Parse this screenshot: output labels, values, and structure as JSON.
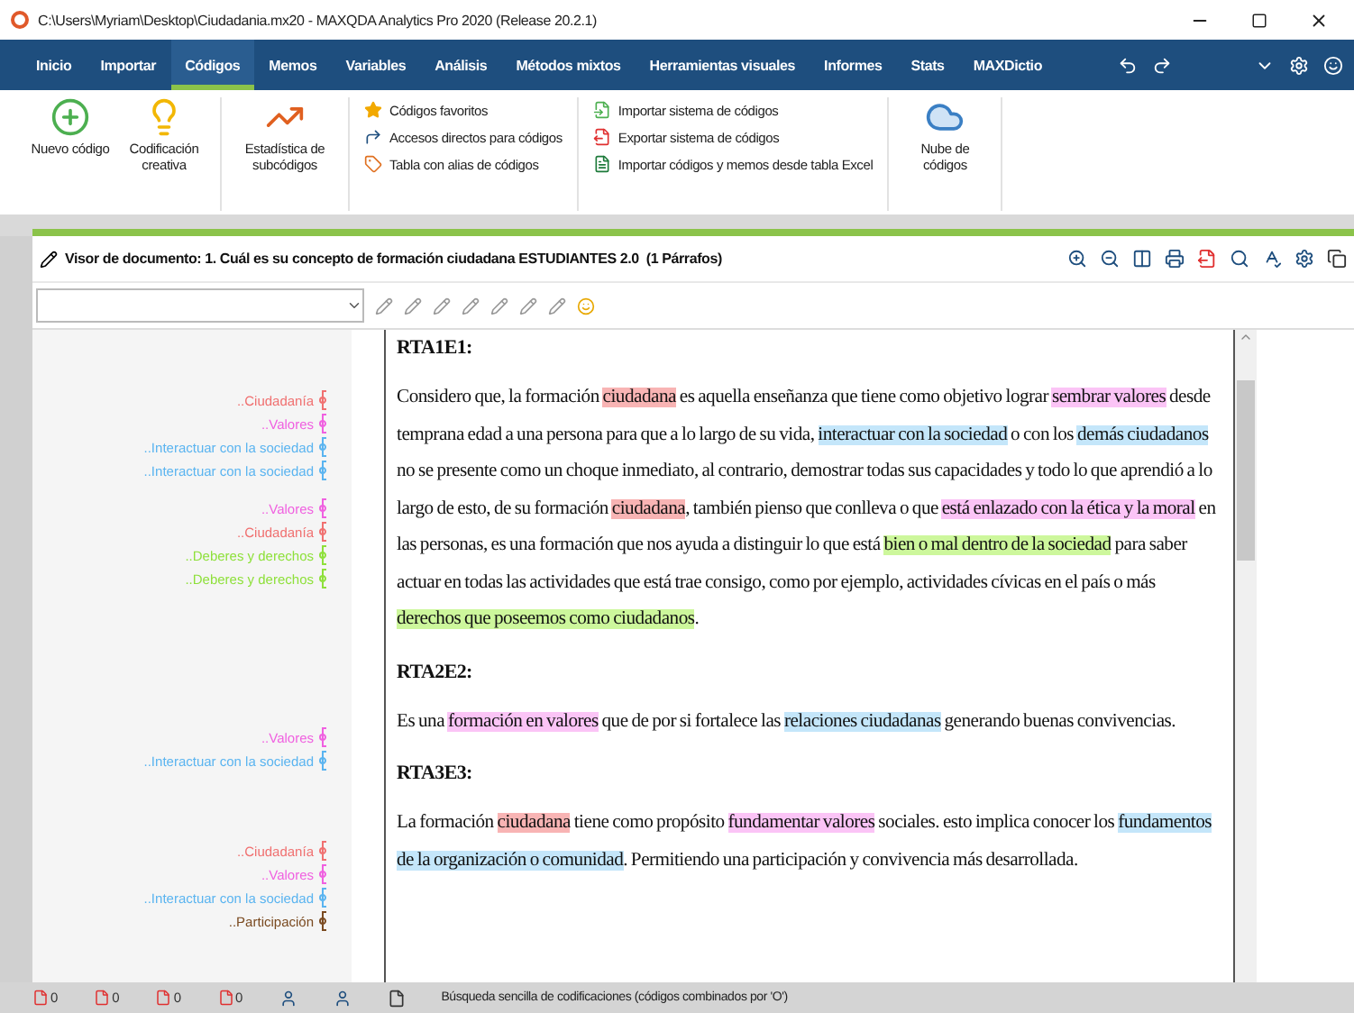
{
  "window": {
    "title": "C:\\Users\\Myriam\\Desktop\\Ciudadania.mx20 - MAXQDA Analytics Pro 2020 (Release 20.2.1)"
  },
  "menu": {
    "tabs": [
      {
        "label": "Inicio",
        "selected": false
      },
      {
        "label": "Importar",
        "selected": false
      },
      {
        "label": "Códigos",
        "selected": true
      },
      {
        "label": "Memos",
        "selected": false
      },
      {
        "label": "Variables",
        "selected": false
      },
      {
        "label": "Análisis",
        "selected": false
      },
      {
        "label": "Métodos mixtos",
        "selected": false
      },
      {
        "label": "Herramientas visuales",
        "selected": false
      },
      {
        "label": "Informes",
        "selected": false
      },
      {
        "label": "Stats",
        "selected": false
      },
      {
        "label": "MAXDictio",
        "selected": false
      }
    ]
  },
  "ribbon": {
    "large_buttons": [
      {
        "kind": "new",
        "label": "Nuevo código"
      },
      {
        "kind": "creative",
        "label": "Codificación creativa"
      },
      {
        "kind": "stats",
        "label": "Estadística de subcódigos"
      }
    ],
    "list_1": [
      {
        "kind": "star",
        "label": "Códigos favoritos"
      },
      {
        "kind": "shortcut",
        "label": "Accesos directos para códigos"
      },
      {
        "kind": "tag",
        "label": "Tabla con alias de códigos"
      }
    ],
    "list_2": [
      {
        "kind": "import",
        "label": "Importar sistema de códigos"
      },
      {
        "kind": "export",
        "label": "Exportar sistema de códigos"
      },
      {
        "kind": "excel",
        "label": "Importar códigos y memos desde tabla Excel"
      }
    ],
    "cloud_button": "Nube de códigos"
  },
  "viewer": {
    "title": "Visor de documento: 1. Cuál es su concepto de formación ciudadana ESTUDIANTES 2.0",
    "count": "(1 Párrafos)"
  },
  "margin_groups": [
    {
      "codes": [
        {
          "label": "..Ciudadanía",
          "color": "#f07070"
        },
        {
          "label": "..Valores",
          "color": "#f060e0"
        },
        {
          "label": "..Interactuar con la sociedad",
          "color": "#5ab4f0"
        },
        {
          "label": "..Interactuar con la sociedad",
          "color": "#5ab4f0"
        }
      ]
    },
    {
      "codes": [
        {
          "label": "..Valores",
          "color": "#f060e0"
        },
        {
          "label": "..Ciudadanía",
          "color": "#f07070"
        },
        {
          "label": "..Deberes y derechos",
          "color": "#8ee03a"
        },
        {
          "label": "..Deberes y derechos",
          "color": "#8ee03a"
        }
      ]
    },
    {
      "codes": [
        {
          "label": "..Valores",
          "color": "#f060e0"
        },
        {
          "label": "..Interactuar con la sociedad",
          "color": "#5ab4f0"
        }
      ]
    },
    {
      "codes": [
        {
          "label": "..Ciudadanía",
          "color": "#f07070"
        },
        {
          "label": "..Valores",
          "color": "#f060e0"
        },
        {
          "label": "..Interactuar con la sociedad",
          "color": "#5ab4f0"
        },
        {
          "label": "..Participación",
          "color": "#7a4a20"
        }
      ]
    }
  ],
  "paragraphs": [
    {
      "heading": "RTA1E1:",
      "segments": [
        {
          "text": "Considero que, la formación "
        },
        {
          "text": "ciudadana",
          "color": "#f8b4b4"
        },
        {
          "text": " es aquella enseñanza que tiene como objetivo lograr "
        },
        {
          "text": "sembrar valores",
          "color": "#fbc4f6"
        },
        {
          "text": " desde temprana edad a una persona para que a lo largo de su vida, "
        },
        {
          "text": "interactuar con la sociedad",
          "color": "#c4e6fa"
        },
        {
          "text": " o con los "
        },
        {
          "text": "demás ciudadanos",
          "color": "#c4e6fa"
        },
        {
          "text": " no se presente como un choque inmediato, al contrario, demostrar todas sus capacidades y todo lo que aprendió a lo largo de esto, de su formación "
        },
        {
          "text": "ciudadana",
          "color": "#f8b4b4"
        },
        {
          "text": ", también pienso que conlleva o que "
        },
        {
          "text": "está enlazado con la ética y la moral",
          "color": "#fbc4f6"
        },
        {
          "text": " en las personas, es una formación que nos ayuda a distinguir lo que está "
        },
        {
          "text": "bien o mal dentro de la sociedad",
          "color": "#cdf79c"
        },
        {
          "text": " para saber actuar en todas las actividades que está trae consigo, como por ejemplo, actividades cívicas en el país o más "
        },
        {
          "text": "derechos que poseemos como ciudadanos",
          "color": "#cdf79c"
        },
        {
          "text": "."
        }
      ]
    },
    {
      "heading": "RTA2E2:",
      "segments": [
        {
          "text": "Es una "
        },
        {
          "text": "formación en valores",
          "color": "#fbc4f6"
        },
        {
          "text": " que de por si fortalece las "
        },
        {
          "text": "relaciones ciudadanas",
          "color": "#c4e6fa"
        },
        {
          "text": " generando buenas convivencias."
        }
      ]
    },
    {
      "heading": "RTA3E3:",
      "segments": [
        {
          "text": "La formación "
        },
        {
          "text": "ciudadana",
          "color": "#f8b4b4"
        },
        {
          "text": " tiene como propósito "
        },
        {
          "text": "fundamentar valores",
          "color": "#fbc4f6"
        },
        {
          "text": " sociales. esto implica conocer los "
        },
        {
          "text": "fundamentos de la organización o comunidad",
          "color": "#c4e6fa"
        },
        {
          "text": ". Permitiendo una participación y convivencia más desarrollada."
        }
      ]
    }
  ],
  "status": {
    "counts": [
      "0",
      "0",
      "0",
      "0"
    ],
    "search_mode": "Búsqueda sencilla de codificaciones (códigos combinados por 'O')"
  }
}
